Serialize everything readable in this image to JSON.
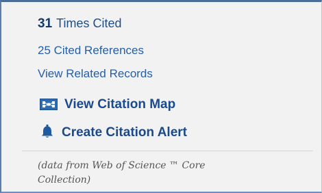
{
  "citations": {
    "times_cited_count": "31",
    "times_cited_label": "Times Cited",
    "cited_references": "25 Cited References",
    "related_records": "View Related Records"
  },
  "actions": {
    "citation_map": {
      "label": "View Citation Map",
      "icon": "citation-map-icon"
    },
    "citation_alert": {
      "label": "Create Citation Alert",
      "icon": "bell-icon"
    }
  },
  "note": "(data from Web of Science ™ Core Collection)",
  "colors": {
    "link": "#245ea8",
    "action": "#1a4a8c",
    "panel_background": "#f2f2f2",
    "border": "#4a6e99"
  }
}
